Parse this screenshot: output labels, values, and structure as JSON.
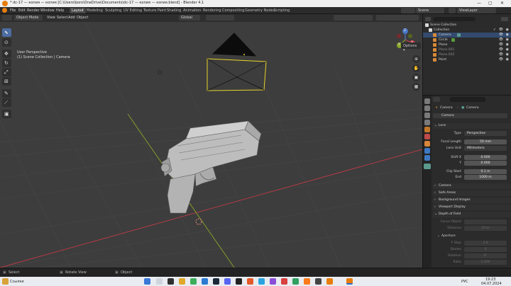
{
  "titlebar": {
    "title": "* dc-17 — копия — копия [C:\\Users\\boro\\OneDrive\\Documents\\dc-17 — копия — копия.blend] - Blender 4.1",
    "minimize": "—",
    "maximize": "▢",
    "close": "✕"
  },
  "menus": [
    "File",
    "Edit",
    "Render",
    "Window",
    "Help"
  ],
  "workspaces": [
    "Layout",
    "Modeling",
    "Sculpting",
    "UV Editing",
    "Texture Paint",
    "Shading",
    "Animation",
    "Rendering",
    "Compositing",
    "Geometry Nodes",
    "Scripting"
  ],
  "active_workspace": "Layout",
  "scene_selector": "Scene",
  "view_layer": "ViewLayer",
  "viewport_header": {
    "mode": "Object Mode",
    "view": "View",
    "select": "Select",
    "add": "Add",
    "object": "Object",
    "orientation": "Global",
    "options": "Options"
  },
  "viewport": {
    "info_line1": "User Perspective",
    "info_line2": "(1) Scene Collection | Camera",
    "nav_gizmo": {
      "x": "X",
      "y": "Y",
      "z": "Z"
    }
  },
  "outliner": {
    "root": "Scene Collection",
    "collection": "Collection",
    "objects": [
      {
        "name": "Camera",
        "color": "#d98a36"
      },
      {
        "name": "Circle",
        "color": "#d98a36"
      },
      {
        "name": "Plane",
        "color": "#d98a36"
      },
      {
        "name": "Plane.001",
        "color": "#d98a36"
      },
      {
        "name": "Plane.002",
        "color": "#d98a36"
      },
      {
        "name": "Point",
        "color": "#d98a36"
      }
    ]
  },
  "properties": {
    "header_object": "Camera",
    "breadcrumb_object": "Camera",
    "breadcrumb_data": "Camera",
    "datablock": "Camera",
    "lens_section": "Lens",
    "type_label": "Type",
    "type_value": "Perspective",
    "focal_label": "Focal Length",
    "focal_value": "50 mm",
    "unit_label": "Lens Unit",
    "unit_value": "Millimeters",
    "shiftx_label": "Shift X",
    "shiftx_value": "0.000",
    "shifty_label": "Y",
    "shifty_value": "0.000",
    "clipstart_label": "Clip Start",
    "clipstart_value": "0.1 m",
    "end_label": "End",
    "end_value": "1000 m",
    "sec_camera": "Camera",
    "sec_safe": "Safe Areas",
    "sec_bg": "Background Images",
    "sec_vp": "Viewport Display",
    "sec_dof": "Depth of Field",
    "focus_obj_label": "Focus Object",
    "distance_label": "Distance",
    "distance_value": "10 m",
    "sub_aperture": "Aperture",
    "fstop_label": "F-Stop",
    "fstop_value": "2.8",
    "blades_label": "Blades",
    "blades_value": "0",
    "rotation_label": "Rotation",
    "rotation_value": "0°",
    "ratio_label": "Ratio",
    "ratio_value": "1.000"
  },
  "statusbar": {
    "select": "Select",
    "rotate": "Rotate View",
    "object": "Object"
  },
  "taskbar": {
    "weather": "Ссылки",
    "lang": "РУС",
    "time": "19:23",
    "date": "04.07.2024"
  },
  "colors": {
    "viewport_bg": "#3d3d3d",
    "camera_selected": "#e8d32c",
    "x_axis": "#c23a47",
    "y_axis": "#8aa52a",
    "accent": "#4c6da3",
    "orange": "#e87d0d"
  }
}
